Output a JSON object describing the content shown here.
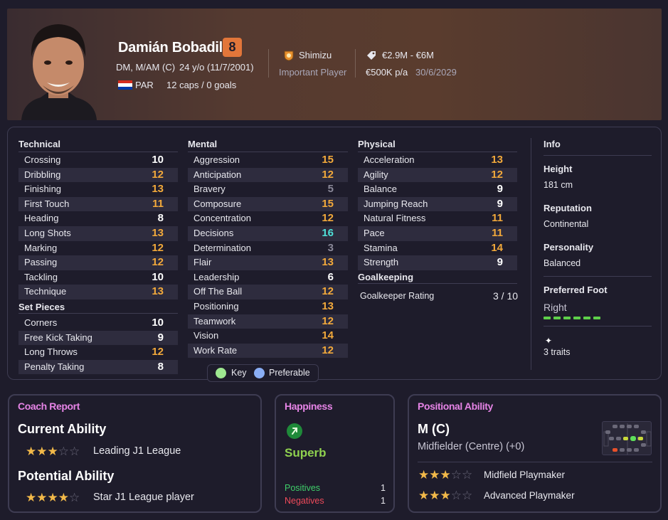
{
  "player": {
    "name": "Damián Bobadilla",
    "number": "8",
    "positions": "DM, M/AM (C)",
    "age_dob": "24 y/o (11/7/2001)",
    "nation": "PAR",
    "caps": "12 caps / 0 goals",
    "club": "Shimizu",
    "squad_status": "Important Player",
    "value": "€2.9M - €6M",
    "wage": "€500K p/a",
    "contract_end": "30/6/2029"
  },
  "technical": {
    "title": "Technical",
    "items": [
      {
        "name": "Crossing",
        "value": "10",
        "tone": "w"
      },
      {
        "name": "Dribbling",
        "value": "12",
        "tone": "o"
      },
      {
        "name": "Finishing",
        "value": "13",
        "tone": "o"
      },
      {
        "name": "First Touch",
        "value": "11",
        "tone": "o"
      },
      {
        "name": "Heading",
        "value": "8",
        "tone": "w"
      },
      {
        "name": "Long Shots",
        "value": "13",
        "tone": "o"
      },
      {
        "name": "Marking",
        "value": "12",
        "tone": "o"
      },
      {
        "name": "Passing",
        "value": "12",
        "tone": "o"
      },
      {
        "name": "Tackling",
        "value": "10",
        "tone": "w"
      },
      {
        "name": "Technique",
        "value": "13",
        "tone": "o"
      }
    ]
  },
  "set_pieces": {
    "title": "Set Pieces",
    "items": [
      {
        "name": "Corners",
        "value": "10",
        "tone": "w"
      },
      {
        "name": "Free Kick Taking",
        "value": "9",
        "tone": "w"
      },
      {
        "name": "Long Throws",
        "value": "12",
        "tone": "o"
      },
      {
        "name": "Penalty Taking",
        "value": "8",
        "tone": "w"
      }
    ]
  },
  "mental": {
    "title": "Mental",
    "items": [
      {
        "name": "Aggression",
        "value": "15",
        "tone": "o"
      },
      {
        "name": "Anticipation",
        "value": "12",
        "tone": "o"
      },
      {
        "name": "Bravery",
        "value": "5",
        "tone": "g"
      },
      {
        "name": "Composure",
        "value": "15",
        "tone": "o"
      },
      {
        "name": "Concentration",
        "value": "12",
        "tone": "o"
      },
      {
        "name": "Decisions",
        "value": "16",
        "tone": "c"
      },
      {
        "name": "Determination",
        "value": "3",
        "tone": "g"
      },
      {
        "name": "Flair",
        "value": "13",
        "tone": "o"
      },
      {
        "name": "Leadership",
        "value": "6",
        "tone": "w"
      },
      {
        "name": "Off The Ball",
        "value": "12",
        "tone": "o"
      },
      {
        "name": "Positioning",
        "value": "13",
        "tone": "o"
      },
      {
        "name": "Teamwork",
        "value": "12",
        "tone": "o"
      },
      {
        "name": "Vision",
        "value": "14",
        "tone": "o"
      },
      {
        "name": "Work Rate",
        "value": "12",
        "tone": "o"
      }
    ]
  },
  "physical": {
    "title": "Physical",
    "items": [
      {
        "name": "Acceleration",
        "value": "13",
        "tone": "o"
      },
      {
        "name": "Agility",
        "value": "12",
        "tone": "o"
      },
      {
        "name": "Balance",
        "value": "9",
        "tone": "w"
      },
      {
        "name": "Jumping Reach",
        "value": "9",
        "tone": "w"
      },
      {
        "name": "Natural Fitness",
        "value": "11",
        "tone": "o"
      },
      {
        "name": "Pace",
        "value": "11",
        "tone": "o"
      },
      {
        "name": "Stamina",
        "value": "14",
        "tone": "o"
      },
      {
        "name": "Strength",
        "value": "9",
        "tone": "w"
      }
    ]
  },
  "goalkeeping": {
    "title": "Goalkeeping",
    "label": "Goalkeeper Rating",
    "value": "3 / 10"
  },
  "info": {
    "title": "Info",
    "height_label": "Height",
    "height": "181 cm",
    "reputation_label": "Reputation",
    "reputation": "Continental",
    "personality_label": "Personality",
    "personality": "Balanced",
    "foot_label": "Preferred Foot",
    "foot": "Right",
    "traits": "3 traits"
  },
  "legend": {
    "key": "Key",
    "preferable": "Preferable"
  },
  "coach_report": {
    "title": "Coach Report",
    "current_label": "Current Ability",
    "current_stars": 3,
    "current_text": "Leading J1 League",
    "potential_label": "Potential Ability",
    "potential_stars": 4,
    "potential_text": "Star J1 League player"
  },
  "happiness": {
    "title": "Happiness",
    "status": "Superb",
    "positives_label": "Positives",
    "positives": "1",
    "negatives_label": "Negatives",
    "negatives": "1"
  },
  "positional": {
    "title": "Positional Ability",
    "position": "M (C)",
    "description": "Midfielder (Centre) (+0)",
    "roles": [
      {
        "name": "Midfield Playmaker",
        "stars": 3
      },
      {
        "name": "Advanced Playmaker",
        "stars": 3
      }
    ]
  },
  "colors": {
    "accent": "#e684e6",
    "orange": "#f2a93b",
    "cyan": "#4fe0d8",
    "green": "#5fd04a",
    "badge": "#e2763a"
  }
}
